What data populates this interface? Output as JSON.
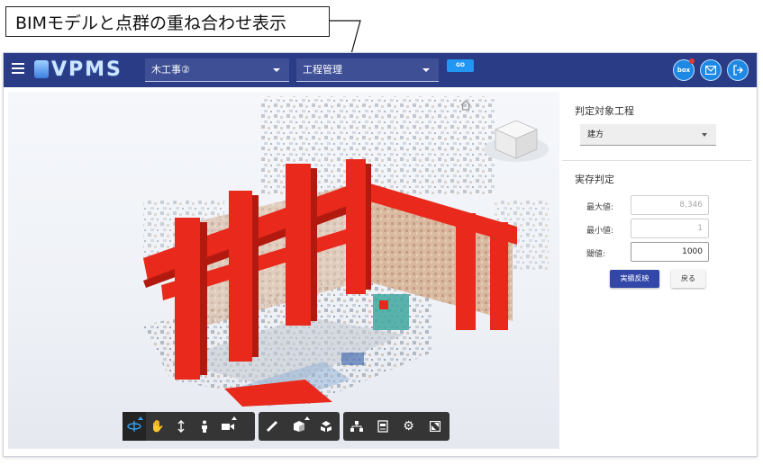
{
  "callout": {
    "text": "BIMモデルと点群の重ね合わせ表示"
  },
  "header": {
    "logo_text": "VPMS",
    "project_select": {
      "value": "木工事②"
    },
    "process_select": {
      "value": "工程管理"
    },
    "go_label": "GO",
    "box_label": "box",
    "accent": "#2a3c86"
  },
  "viewer": {
    "toolbar": {
      "group1": [
        "orbit-icon",
        "pan-icon",
        "zoom-icon",
        "first-person-icon",
        "camera-icon"
      ],
      "group2": [
        "measure-icon",
        "section-icon",
        "explode-icon"
      ],
      "group3": [
        "model-browser-icon",
        "properties-icon",
        "settings-icon",
        "fullscreen-icon"
      ]
    },
    "model_color": "#e8291c"
  },
  "panel": {
    "target_process_title": "判定対象工程",
    "target_process_value": "建方",
    "judgement_title": "実存判定",
    "max_label": "最大値:",
    "max_value": "8,346",
    "min_label": "最小値:",
    "min_value": "1",
    "threshold_label": "閾値:",
    "threshold_value": "1000",
    "apply_button": "実績反映",
    "back_button": "戻る"
  }
}
